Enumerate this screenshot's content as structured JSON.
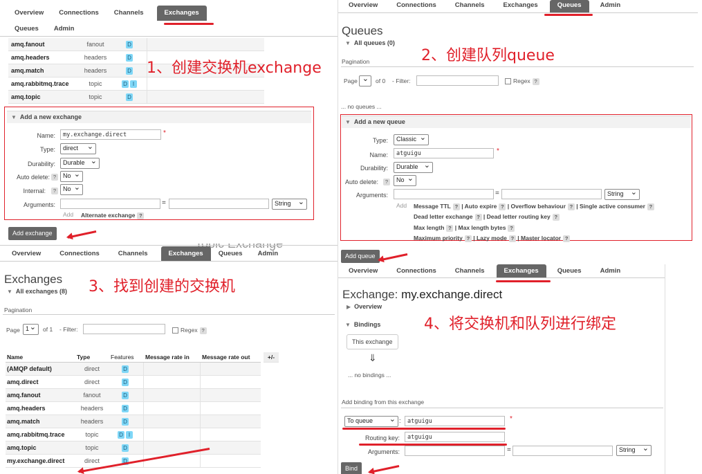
{
  "nav": {
    "overview": "Overview",
    "connections": "Connections",
    "channels": "Channels",
    "exchanges": "Exchanges",
    "queues": "Queues",
    "admin": "Admin"
  },
  "annotations": {
    "step1": "1、创建交换机exchange",
    "step2": "2、创建队列queue",
    "step3": "3、找到创建的交换机",
    "step4": "4、将交换机和队列进行绑定"
  },
  "tl": {
    "exchanges": [
      {
        "name": "amq.fanout",
        "type": "fanout",
        "features": [
          "D"
        ]
      },
      {
        "name": "amq.headers",
        "type": "headers",
        "features": [
          "D"
        ]
      },
      {
        "name": "amq.match",
        "type": "headers",
        "features": [
          "D"
        ]
      },
      {
        "name": "amq.rabbitmq.trace",
        "type": "topic",
        "features": [
          "D",
          "I"
        ]
      },
      {
        "name": "amq.topic",
        "type": "topic",
        "features": [
          "D"
        ]
      }
    ],
    "add_title": "Add a new exchange",
    "labels": {
      "name": "Name:",
      "type": "Type:",
      "durability": "Durability:",
      "auto_delete": "Auto delete:",
      "internal": "Internal:",
      "arguments": "Arguments:"
    },
    "name_value": "my.exchange.direct",
    "type_value": "direct",
    "durability_value": "Durable",
    "auto_delete_value": "No",
    "internal_value": "No",
    "arg_type": "String",
    "add_label": "Add",
    "alternate": "Alternate exchange",
    "button": "Add exchange"
  },
  "tr": {
    "title": "Queues",
    "all_queues": "All queues (0)",
    "pagination": "Pagination",
    "page_label": "Page",
    "of": "of 0",
    "filter": "- Filter:",
    "regex": "Regex",
    "no_queues": "... no queues ...",
    "add_title": "Add a new queue",
    "labels": {
      "type": "Type:",
      "name": "Name:",
      "durability": "Durability:",
      "auto_delete": "Auto delete:",
      "arguments": "Arguments:"
    },
    "type_value": "Classic",
    "name_value": "atguigu",
    "durability_value": "Durable",
    "auto_delete_value": "No",
    "arg_type": "String",
    "add_label": "Add",
    "args_row1": [
      "Message TTL",
      "Auto expire",
      "Overflow behaviour",
      "Single active consumer"
    ],
    "args_row2": [
      "Dead letter exchange",
      "Dead letter routing key"
    ],
    "args_row3": [
      "Max length",
      "Max length bytes"
    ],
    "args_row4": [
      "Maximum priority",
      "Lazy mode",
      "Master locator"
    ],
    "button": "Add queue"
  },
  "bl": {
    "behind_title": "Topic Exchange",
    "title": "Exchanges",
    "all": "All exchanges (8)",
    "pagination": "Pagination",
    "page_label": "Page",
    "page_value": "1",
    "of": "of 1",
    "filter": "- Filter:",
    "regex": "Regex",
    "headers": [
      "Name",
      "Type",
      "Features",
      "Message rate in",
      "Message rate out",
      "+/-"
    ],
    "rows": [
      {
        "name": "(AMQP default)",
        "type": "direct",
        "features": [
          "D"
        ]
      },
      {
        "name": "amq.direct",
        "type": "direct",
        "features": [
          "D"
        ]
      },
      {
        "name": "amq.fanout",
        "type": "fanout",
        "features": [
          "D"
        ]
      },
      {
        "name": "amq.headers",
        "type": "headers",
        "features": [
          "D"
        ]
      },
      {
        "name": "amq.match",
        "type": "headers",
        "features": [
          "D"
        ]
      },
      {
        "name": "amq.rabbitmq.trace",
        "type": "topic",
        "features": [
          "D",
          "I"
        ]
      },
      {
        "name": "amq.topic",
        "type": "topic",
        "features": [
          "D"
        ]
      },
      {
        "name": "my.exchange.direct",
        "type": "direct",
        "features": [
          "D"
        ]
      }
    ]
  },
  "br": {
    "title_prefix": "Exchange:",
    "title_name": "my.exchange.direct",
    "overview": "Overview",
    "bindings": "Bindings",
    "this_exchange": "This exchange",
    "arrow_down": "⇓",
    "no_bindings": "... no bindings ...",
    "add_binding": "Add binding from this exchange",
    "to_queue": "To queue",
    "queue_value": "atguigu",
    "routing_label": "Routing key:",
    "routing_value": "atguigu",
    "arguments_label": "Arguments:",
    "arg_type": "String",
    "button": "Bind"
  }
}
